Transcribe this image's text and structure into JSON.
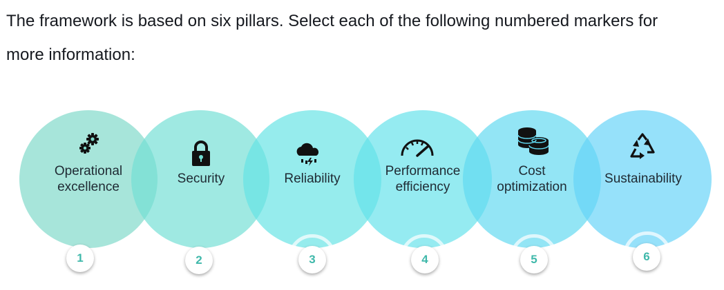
{
  "intro": {
    "line1": "The framework is based on six pillars. Select each of the following numbered markers for",
    "line2": "more information:"
  },
  "colors": {
    "marker_text": "#3fb8aa",
    "circles": [
      "#7dd9c9",
      "#72dfd4",
      "#64e3e4",
      "#63e1ea",
      "#60d8f0",
      "#64d3f7"
    ]
  },
  "pillars": [
    {
      "icon": "gears-icon",
      "label_lines": [
        "Operational",
        "excellence"
      ],
      "marker": "1"
    },
    {
      "icon": "padlock-icon",
      "label_lines": [
        "Security"
      ],
      "marker": "2"
    },
    {
      "icon": "storm-cloud-icon",
      "label_lines": [
        "Reliability"
      ],
      "marker": "3"
    },
    {
      "icon": "speedometer-icon",
      "label_lines": [
        "Performance",
        "efficiency"
      ],
      "marker": "4"
    },
    {
      "icon": "coin-stack-icon",
      "label_lines": [
        "Cost",
        "optimization"
      ],
      "marker": "5"
    },
    {
      "icon": "recycle-icon",
      "label_lines": [
        "Sustainability"
      ],
      "marker": "6"
    }
  ]
}
